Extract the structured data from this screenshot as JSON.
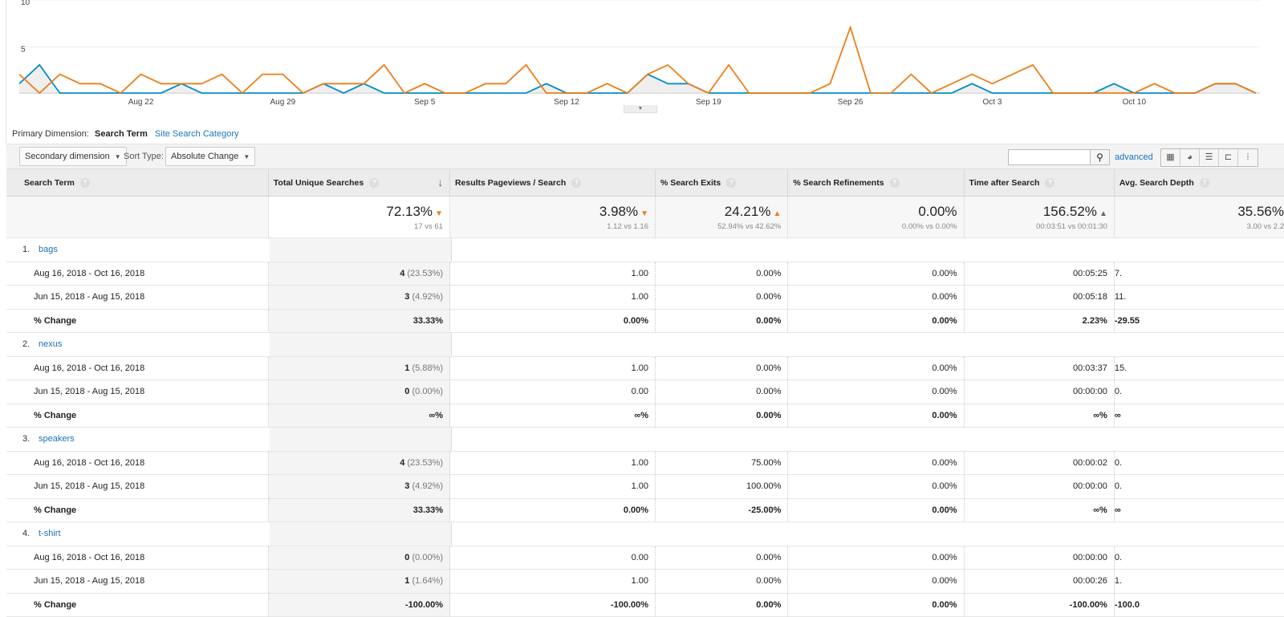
{
  "chart_data": {
    "type": "line",
    "y_ticks": [
      "5",
      "10"
    ],
    "ylim": [
      0,
      10
    ],
    "x_tick_labels": [
      "Aug 22",
      "Aug 29",
      "Sep 5",
      "Sep 12",
      "Sep 19",
      "Sep 26",
      "Oct 3",
      "Oct 10"
    ],
    "x_tick_day_index": [
      6,
      13,
      20,
      27,
      34,
      41,
      48,
      55
    ],
    "x_start": "Aug 16",
    "x_end": "Oct 16",
    "grid": true,
    "series": [
      {
        "color": "#058dc7",
        "filled": true,
        "values": [
          1,
          3,
          0,
          0,
          0,
          0,
          0,
          0,
          1,
          0,
          0,
          0,
          0,
          0,
          0,
          1,
          0,
          1,
          0,
          0,
          0,
          0,
          0,
          0,
          0,
          0,
          1,
          0,
          0,
          0,
          0,
          2,
          1,
          1,
          0,
          0,
          0,
          0,
          0,
          0,
          0,
          0,
          0,
          0,
          0,
          0,
          0,
          1,
          0,
          0,
          0,
          0,
          0,
          0,
          1,
          0,
          0,
          0,
          0,
          1,
          1,
          0
        ]
      },
      {
        "color": "#ed7e17",
        "filled": false,
        "values": [
          2,
          0,
          2,
          1,
          1,
          0,
          2,
          1,
          1,
          1,
          2,
          0,
          2,
          2,
          0,
          1,
          1,
          1,
          3,
          0,
          1,
          0,
          0,
          1,
          1,
          3,
          0,
          0,
          0,
          1,
          0,
          2,
          3,
          1,
          0,
          3,
          0,
          0,
          0,
          0,
          1,
          7,
          0,
          0,
          2,
          0,
          1,
          2,
          1,
          2,
          3,
          0,
          0,
          0,
          0,
          0,
          1,
          0,
          0,
          1,
          1,
          0
        ]
      }
    ]
  },
  "dimension": {
    "label": "Primary Dimension:",
    "active": "Search Term",
    "other": "Site Search Category"
  },
  "toolbar": {
    "secondary": "Secondary dimension",
    "sort_label": "Sort Type:",
    "sort_value": "Absolute Change",
    "advanced": "advanced",
    "search_value": ""
  },
  "columns": [
    "Search Term",
    "Total Unique Searches",
    "Results Pageviews / Search",
    "% Search Exits",
    "% Search Refinements",
    "Time after Search",
    "Avg. Search Depth"
  ],
  "summary": [
    {
      "value": "72.13%",
      "dir": "down",
      "compare": "17 vs 61"
    },
    {
      "value": "3.98%",
      "dir": "down",
      "compare": "1.12 vs 1.16"
    },
    {
      "value": "24.21%",
      "dir": "up",
      "compare": "52.94% vs 42.62%"
    },
    {
      "value": "0.00%",
      "dir": "",
      "compare": "0.00% vs 0.00%"
    },
    {
      "value": "156.52%",
      "dir": "up-gray",
      "compare": "00:03:51 vs 00:01:30"
    },
    {
      "value": "35.56%",
      "dir": "",
      "compare": "3.00 vs 2.2"
    }
  ],
  "colors": {
    "down": "#ed7e17",
    "up": "#ed7e17",
    "up-gray": "#666666",
    "link": "#1a73b8"
  },
  "rows": [
    {
      "num": "1.",
      "term": "bags",
      "sub": [
        {
          "label": "Aug 16, 2018 - Oct 16, 2018",
          "tus": "4",
          "tus_pct": "(23.53%)",
          "vals": [
            "1.00",
            "0.00%",
            "0.00%",
            "00:05:25",
            "7."
          ]
        },
        {
          "label": "Jun 15, 2018 - Aug 15, 2018",
          "tus": "3",
          "tus_pct": "(4.92%)",
          "vals": [
            "1.00",
            "0.00%",
            "0.00%",
            "00:05:18",
            "11."
          ]
        }
      ],
      "change": {
        "label": "% Change",
        "vals": [
          "33.33%",
          "0.00%",
          "0.00%",
          "0.00%",
          "2.23%",
          "-29.55"
        ]
      }
    },
    {
      "num": "2.",
      "term": "nexus",
      "sub": [
        {
          "label": "Aug 16, 2018 - Oct 16, 2018",
          "tus": "1",
          "tus_pct": "(5.88%)",
          "vals": [
            "1.00",
            "0.00%",
            "0.00%",
            "00:03:37",
            "15."
          ]
        },
        {
          "label": "Jun 15, 2018 - Aug 15, 2018",
          "tus": "0",
          "tus_pct": "(0.00%)",
          "vals": [
            "0.00",
            "0.00%",
            "0.00%",
            "00:00:00",
            "0."
          ]
        }
      ],
      "change": {
        "label": "% Change",
        "vals": [
          "∞%",
          "∞%",
          "0.00%",
          "0.00%",
          "∞%",
          "∞"
        ]
      }
    },
    {
      "num": "3.",
      "term": "speakers",
      "sub": [
        {
          "label": "Aug 16, 2018 - Oct 16, 2018",
          "tus": "4",
          "tus_pct": "(23.53%)",
          "vals": [
            "1.00",
            "75.00%",
            "0.00%",
            "00:00:02",
            "0."
          ]
        },
        {
          "label": "Jun 15, 2018 - Aug 15, 2018",
          "tus": "3",
          "tus_pct": "(4.92%)",
          "vals": [
            "1.00",
            "100.00%",
            "0.00%",
            "00:00:00",
            "0."
          ]
        }
      ],
      "change": {
        "label": "% Change",
        "vals": [
          "33.33%",
          "0.00%",
          "-25.00%",
          "0.00%",
          "∞%",
          "∞"
        ]
      }
    },
    {
      "num": "4.",
      "term": "t-shirt",
      "sub": [
        {
          "label": "Aug 16, 2018 - Oct 16, 2018",
          "tus": "0",
          "tus_pct": "(0.00%)",
          "vals": [
            "0.00",
            "0.00%",
            "0.00%",
            "00:00:00",
            "0."
          ]
        },
        {
          "label": "Jun 15, 2018 - Aug 15, 2018",
          "tus": "1",
          "tus_pct": "(1.64%)",
          "vals": [
            "1.00",
            "0.00%",
            "0.00%",
            "00:00:26",
            "1."
          ]
        }
      ],
      "change": {
        "label": "% Change",
        "vals": [
          "-100.00%",
          "-100.00%",
          "0.00%",
          "0.00%",
          "-100.00%",
          "-100.0"
        ]
      }
    }
  ]
}
